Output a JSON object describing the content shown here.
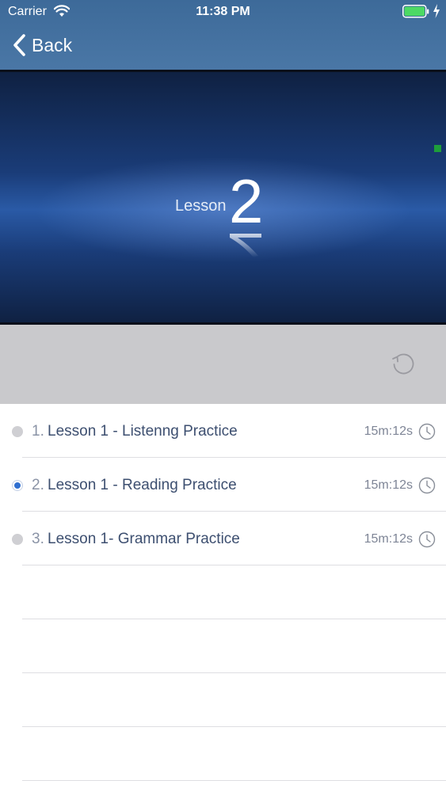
{
  "status_bar": {
    "carrier": "Carrier",
    "time": "11:38 PM",
    "battery_color": "#4cd964"
  },
  "nav": {
    "back_label": "Back"
  },
  "video": {
    "lesson_word": "Lesson",
    "lesson_number": "2"
  },
  "lessons": [
    {
      "index": "1.",
      "title": "Lesson 1 - Listenng Practice",
      "duration": "15m:12s",
      "selected": false
    },
    {
      "index": "2.",
      "title": "Lesson 1 - Reading Practice",
      "duration": "15m:12s",
      "selected": true
    },
    {
      "index": "3.",
      "title": "Lesson 1- Grammar Practice",
      "duration": "15m:12s",
      "selected": false
    }
  ],
  "icons": {
    "back": "chevron-left-icon",
    "replay": "replay-icon",
    "clock": "clock-icon",
    "wifi": "wifi-icon",
    "battery": "battery-icon"
  },
  "colors": {
    "header": "#4270a0",
    "accent_dot": "#2f6fd0",
    "controls_bg": "#c9c9cc"
  }
}
